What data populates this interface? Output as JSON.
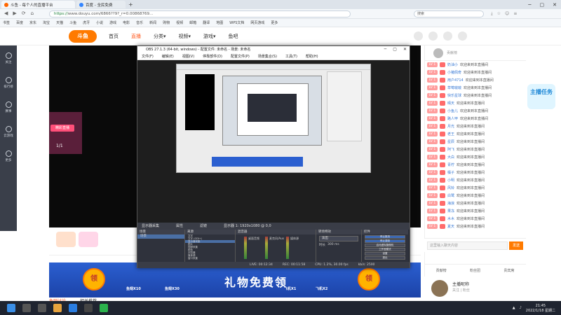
{
  "browser": {
    "tabs": [
      {
        "label": "斗鱼 - 每个人的直播平台"
      },
      {
        "label": "百度 - 全民免费"
      }
    ],
    "new_tab": "+",
    "window_controls": [
      "─",
      "▢",
      "✕"
    ],
    "url_prefix": "https://",
    "url": "www.douyu.com/6866??9?_r=0.00868769...",
    "search_placeholder": "搜索",
    "bookmarks": [
      "书签",
      "百度",
      "京东",
      "淘宝",
      "天猫",
      "斗鱼",
      "虎牙",
      "小说",
      "游戏",
      "电影",
      "音乐",
      "新闻",
      "购物",
      "视频",
      "邮箱",
      "翻译",
      "地图",
      "WPS文档",
      "网页游戏",
      "更多"
    ]
  },
  "header": {
    "logo": "斗鱼",
    "nav": [
      "首页",
      "直播",
      "分类▾",
      "视频▾",
      "游戏▾",
      "鱼吧"
    ],
    "active_nav": "直播"
  },
  "sidebar": {
    "items": [
      "关注",
      "排行榜",
      "赛事",
      "云游戏",
      "更多"
    ]
  },
  "stage": {
    "card_text": "精彩直播",
    "card_count": "1/1"
  },
  "banner": {
    "text": "礼物免费领",
    "left_badge": "领",
    "right_badge": "领",
    "gifts": [
      "鱼翅X10",
      "鱼翅X30",
      "飞机X1",
      "飞机X2"
    ]
  },
  "below": [
    "鱼吧讨论",
    "相关推荐"
  ],
  "obs": {
    "title": "OBS 27.1.3 (64-bit, windows) - 配置文件: 未命名 - 场景: 未命名",
    "title_controls": [
      "─",
      "▢",
      "✕"
    ],
    "menu": [
      "文件(F)",
      "编辑(E)",
      "视图(V)",
      "停靠部件(D)",
      "配置文件(P)",
      "场景集合(S)",
      "工具(T)",
      "帮助(H)"
    ],
    "scenebar": [
      "显示器采集",
      "属性",
      "滤镜",
      "显示器 1: 1920x1080 @ 0,0"
    ],
    "docks": {
      "scenes_title": "场景",
      "scenes": [
        "场景"
      ],
      "sources_title": "来源",
      "sources": [
        "文字",
        "文字 (GDI+)",
        "显示器采集",
        "图片",
        "视频采集",
        "颜色",
        "浏览器",
        "媒体源",
        "窗口采集"
      ],
      "mixer_title": "混音器",
      "mixer_channels": [
        "桌面音频",
        "麦克风/Aux",
        "媒体源"
      ],
      "transitions_title": "转场特效",
      "transition": "淡出",
      "duration_label": "时长",
      "duration": "300 ms",
      "controls_title": "控件",
      "controls": [
        "停止推流",
        "停止录制",
        "启动虚拟摄像机",
        "工作室模式",
        "设置",
        "退出"
      ]
    },
    "status": [
      "LIVE: 00:12:34",
      "REC: 00:11:58",
      "CPU: 1.2%, 30.00 fps",
      "kb/s: 2500"
    ]
  },
  "chat": {
    "header_text": "贡献榜",
    "messages": [
      {
        "name": "奶油小",
        "text": "欢迎来到本直播间"
      },
      {
        "name": "小猪佩奇",
        "text": "欢迎来到本直播间"
      },
      {
        "name": "用户4714",
        "text": "欢迎来到本直播间"
      },
      {
        "name": "草莓啵啵",
        "text": "欢迎来到本直播间"
      },
      {
        "name": "快乐星球",
        "text": "欢迎来到本直播间"
      },
      {
        "name": "晴天",
        "text": "欢迎来到本直播间"
      },
      {
        "name": "小鱼儿",
        "text": "欢迎来到本直播间"
      },
      {
        "name": "路人甲",
        "text": "欢迎来到本直播间"
      },
      {
        "name": "月光",
        "text": "欢迎来到本直播间"
      },
      {
        "name": "老王",
        "text": "欢迎来到本直播间"
      },
      {
        "name": "星辰",
        "text": "欢迎来到本直播间"
      },
      {
        "name": "阿飞",
        "text": "欢迎来到本直播间"
      },
      {
        "name": "大白",
        "text": "欢迎来到本直播间"
      },
      {
        "name": "青柠",
        "text": "欢迎来到本直播间"
      },
      {
        "name": "橘子",
        "text": "欢迎来到本直播间"
      },
      {
        "name": "小明",
        "text": "欢迎来到本直播间"
      },
      {
        "name": "风铃",
        "text": "欢迎来到本直播间"
      },
      {
        "name": "白鹭",
        "text": "欢迎来到本直播间"
      },
      {
        "name": "海浪",
        "text": "欢迎来到本直播间"
      },
      {
        "name": "果冻",
        "text": "欢迎来到本直播间"
      },
      {
        "name": "木木",
        "text": "欢迎来到本直播间"
      },
      {
        "name": "夏天",
        "text": "欢迎来到本直播间"
      }
    ],
    "level": "LV 1",
    "badge_text": "主播任务",
    "input_placeholder": "这里输入聊天内容",
    "send": "发送",
    "rank_tabs": [
      "贡献榜",
      "粉丝团",
      "贵宾席"
    ]
  },
  "streamer": {
    "name": "主播昵称",
    "subtitle": "关注 | 粉丝"
  },
  "taskbar": {
    "time": "21:45",
    "date": "2022/1/18 星期二"
  },
  "colors": {
    "accent": "#ff7a00",
    "douyu_orange": "#ff5d23",
    "obs_dark": "#2b2e38"
  }
}
